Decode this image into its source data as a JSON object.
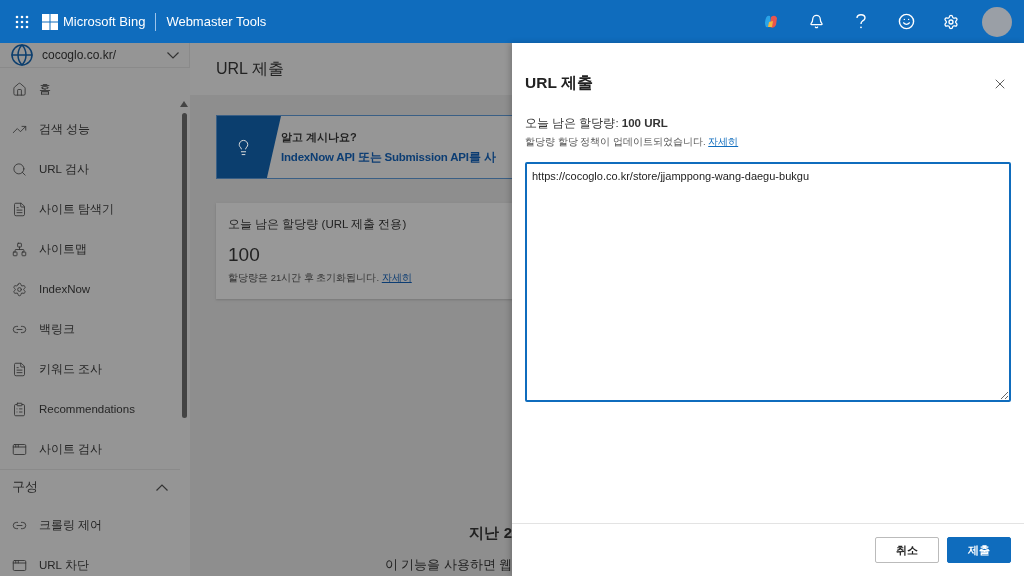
{
  "header": {
    "brand": "Microsoft Bing",
    "product": "Webmaster Tools"
  },
  "sidebar": {
    "site": "cocoglo.co.kr/",
    "items": [
      {
        "label": "홈"
      },
      {
        "label": "검색 성능"
      },
      {
        "label": "URL 검사"
      },
      {
        "label": "사이트 탐색기"
      },
      {
        "label": "사이트맵"
      },
      {
        "label": "IndexNow"
      },
      {
        "label": "백링크"
      },
      {
        "label": "키워드 조사"
      },
      {
        "label": "Recommendations"
      },
      {
        "label": "사이트 검사"
      }
    ],
    "groups": [
      {
        "label": "구성",
        "expanded": true,
        "children": [
          {
            "label": "크롤링 제어"
          },
          {
            "label": "URL 차단"
          }
        ]
      }
    ]
  },
  "main": {
    "title": "URL 제출",
    "banner": {
      "heading": "알고 계시나요?",
      "text": "IndexNow API 또는 Submission API를 사"
    },
    "card": {
      "title": "오늘 남은 할당량 (URL 제출 전용)",
      "value": "100",
      "note": "할당량은 21시간 후 초기화됩니다.",
      "link": "자세히"
    },
    "empty": {
      "heading": "지난 2",
      "text": "이 기능을 사용하면 웹"
    }
  },
  "panel": {
    "title": "URL 제출",
    "quota": "오늘 남은 할당량: **100 URL**",
    "note": "할당량 할당 정책이 업데이트되었습니다.",
    "link": "자세히",
    "url": "https://cocoglo.co.kr/store/jjamppong-wang-daegu-bukgu",
    "buttons": [
      {
        "label": "취소",
        "kind": "secondary"
      },
      {
        "label": "제출",
        "kind": "primary"
      }
    ]
  }
}
